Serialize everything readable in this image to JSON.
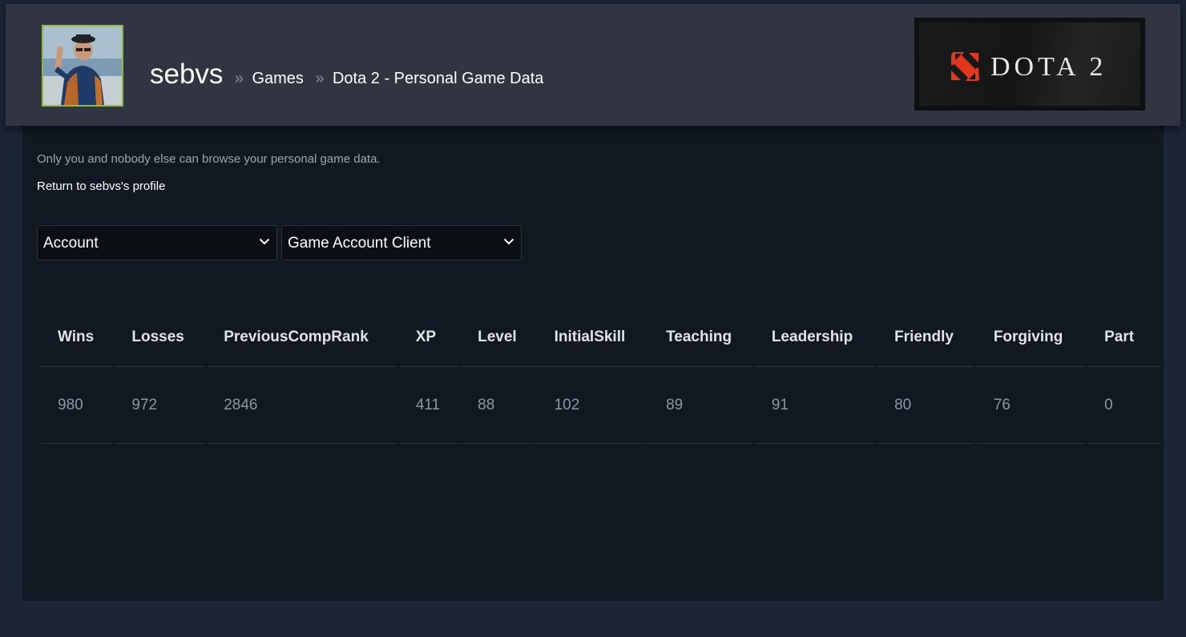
{
  "header": {
    "username": "sebvs",
    "separator": "»",
    "breadcrumbs": [
      "Games",
      "Dota 2 - Personal Game Data"
    ],
    "avatar_icon": "user-avatar",
    "game_logo_text": "DOTA 2",
    "game_logo_icon": "dota-2-emblem",
    "avatar_border_color": "#8fb845"
  },
  "main": {
    "privacy_note": "Only you and nobody else can browse your personal game data.",
    "return_link": "Return to sebvs's profile",
    "selects": [
      {
        "value": "Account"
      },
      {
        "value": "Game Account Client"
      }
    ],
    "table": {
      "columns": [
        "Wins",
        "Losses",
        "PreviousCompRank",
        "XP",
        "Level",
        "InitialSkill",
        "Teaching",
        "Leadership",
        "Friendly",
        "Forgiving",
        "Part"
      ],
      "rows": [
        [
          "980",
          "972",
          "2846",
          "411",
          "88",
          "102",
          "89",
          "91",
          "80",
          "76",
          "0"
        ]
      ]
    }
  },
  "colors": {
    "background": "#1b2535",
    "header_bg": "#313541",
    "panel_bg": "#121821",
    "logo_red": "#e0371e"
  }
}
